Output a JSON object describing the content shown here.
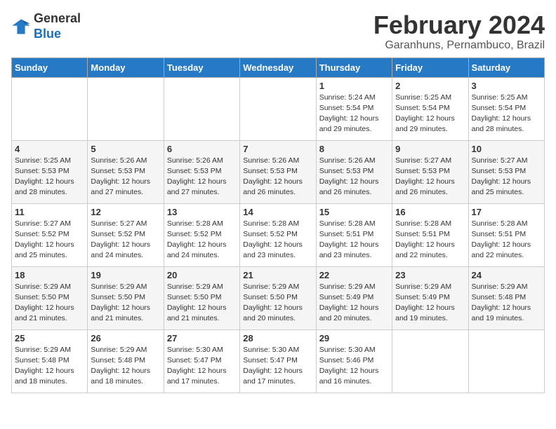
{
  "header": {
    "logo_line1": "General",
    "logo_line2": "Blue",
    "month": "February 2024",
    "location": "Garanhuns, Pernambuco, Brazil"
  },
  "days_of_week": [
    "Sunday",
    "Monday",
    "Tuesday",
    "Wednesday",
    "Thursday",
    "Friday",
    "Saturday"
  ],
  "weeks": [
    [
      {
        "day": "",
        "info": ""
      },
      {
        "day": "",
        "info": ""
      },
      {
        "day": "",
        "info": ""
      },
      {
        "day": "",
        "info": ""
      },
      {
        "day": "1",
        "info": "Sunrise: 5:24 AM\nSunset: 5:54 PM\nDaylight: 12 hours\nand 29 minutes."
      },
      {
        "day": "2",
        "info": "Sunrise: 5:25 AM\nSunset: 5:54 PM\nDaylight: 12 hours\nand 29 minutes."
      },
      {
        "day": "3",
        "info": "Sunrise: 5:25 AM\nSunset: 5:54 PM\nDaylight: 12 hours\nand 28 minutes."
      }
    ],
    [
      {
        "day": "4",
        "info": "Sunrise: 5:25 AM\nSunset: 5:53 PM\nDaylight: 12 hours\nand 28 minutes."
      },
      {
        "day": "5",
        "info": "Sunrise: 5:26 AM\nSunset: 5:53 PM\nDaylight: 12 hours\nand 27 minutes."
      },
      {
        "day": "6",
        "info": "Sunrise: 5:26 AM\nSunset: 5:53 PM\nDaylight: 12 hours\nand 27 minutes."
      },
      {
        "day": "7",
        "info": "Sunrise: 5:26 AM\nSunset: 5:53 PM\nDaylight: 12 hours\nand 26 minutes."
      },
      {
        "day": "8",
        "info": "Sunrise: 5:26 AM\nSunset: 5:53 PM\nDaylight: 12 hours\nand 26 minutes."
      },
      {
        "day": "9",
        "info": "Sunrise: 5:27 AM\nSunset: 5:53 PM\nDaylight: 12 hours\nand 26 minutes."
      },
      {
        "day": "10",
        "info": "Sunrise: 5:27 AM\nSunset: 5:53 PM\nDaylight: 12 hours\nand 25 minutes."
      }
    ],
    [
      {
        "day": "11",
        "info": "Sunrise: 5:27 AM\nSunset: 5:52 PM\nDaylight: 12 hours\nand 25 minutes."
      },
      {
        "day": "12",
        "info": "Sunrise: 5:27 AM\nSunset: 5:52 PM\nDaylight: 12 hours\nand 24 minutes."
      },
      {
        "day": "13",
        "info": "Sunrise: 5:28 AM\nSunset: 5:52 PM\nDaylight: 12 hours\nand 24 minutes."
      },
      {
        "day": "14",
        "info": "Sunrise: 5:28 AM\nSunset: 5:52 PM\nDaylight: 12 hours\nand 23 minutes."
      },
      {
        "day": "15",
        "info": "Sunrise: 5:28 AM\nSunset: 5:51 PM\nDaylight: 12 hours\nand 23 minutes."
      },
      {
        "day": "16",
        "info": "Sunrise: 5:28 AM\nSunset: 5:51 PM\nDaylight: 12 hours\nand 22 minutes."
      },
      {
        "day": "17",
        "info": "Sunrise: 5:28 AM\nSunset: 5:51 PM\nDaylight: 12 hours\nand 22 minutes."
      }
    ],
    [
      {
        "day": "18",
        "info": "Sunrise: 5:29 AM\nSunset: 5:50 PM\nDaylight: 12 hours\nand 21 minutes."
      },
      {
        "day": "19",
        "info": "Sunrise: 5:29 AM\nSunset: 5:50 PM\nDaylight: 12 hours\nand 21 minutes."
      },
      {
        "day": "20",
        "info": "Sunrise: 5:29 AM\nSunset: 5:50 PM\nDaylight: 12 hours\nand 21 minutes."
      },
      {
        "day": "21",
        "info": "Sunrise: 5:29 AM\nSunset: 5:50 PM\nDaylight: 12 hours\nand 20 minutes."
      },
      {
        "day": "22",
        "info": "Sunrise: 5:29 AM\nSunset: 5:49 PM\nDaylight: 12 hours\nand 20 minutes."
      },
      {
        "day": "23",
        "info": "Sunrise: 5:29 AM\nSunset: 5:49 PM\nDaylight: 12 hours\nand 19 minutes."
      },
      {
        "day": "24",
        "info": "Sunrise: 5:29 AM\nSunset: 5:48 PM\nDaylight: 12 hours\nand 19 minutes."
      }
    ],
    [
      {
        "day": "25",
        "info": "Sunrise: 5:29 AM\nSunset: 5:48 PM\nDaylight: 12 hours\nand 18 minutes."
      },
      {
        "day": "26",
        "info": "Sunrise: 5:29 AM\nSunset: 5:48 PM\nDaylight: 12 hours\nand 18 minutes."
      },
      {
        "day": "27",
        "info": "Sunrise: 5:30 AM\nSunset: 5:47 PM\nDaylight: 12 hours\nand 17 minutes."
      },
      {
        "day": "28",
        "info": "Sunrise: 5:30 AM\nSunset: 5:47 PM\nDaylight: 12 hours\nand 17 minutes."
      },
      {
        "day": "29",
        "info": "Sunrise: 5:30 AM\nSunset: 5:46 PM\nDaylight: 12 hours\nand 16 minutes."
      },
      {
        "day": "",
        "info": ""
      },
      {
        "day": "",
        "info": ""
      }
    ]
  ]
}
